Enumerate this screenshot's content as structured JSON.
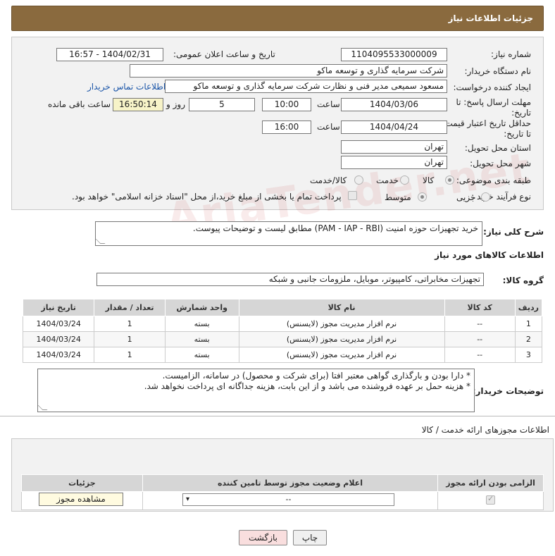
{
  "header": {
    "title": "جزئیات اطلاعات نیاز"
  },
  "form": {
    "need_number_label": "شماره نیاز:",
    "need_number": "1104095533000009",
    "announce_label": "تاریخ و ساعت اعلان عمومی:",
    "announce_value": "1404/02/31 - 16:57",
    "buyer_org_label": "نام دستگاه خریدار:",
    "buyer_org": "شرکت سرمایه گذاری و توسعه ماکو",
    "requester_label": "ایجاد کننده درخواست:",
    "requester": "مسعود سمیعی مدیر فنی و نظارت   شرکت سرمایه گذاری و توسعه ماکو",
    "contact_link": "اطلاعات تماس خریدار",
    "deadline_label": "مهلت ارسال پاسخ: تا تاریخ:",
    "deadline_date": "1404/03/06",
    "time_label": "ساعت",
    "deadline_time": "10:00",
    "days_value": "5",
    "days_label": "روز و",
    "remaining_value": "16:50:14",
    "remaining_label": "ساعت باقی مانده",
    "validity_label": "حداقل تاریخ اعتبار قیمت: تا تاریخ:",
    "validity_date": "1404/04/24",
    "validity_time": "16:00",
    "province_label": "استان محل تحویل:",
    "province": "تهران",
    "city_label": "شهر محل تحویل:",
    "city": "تهران",
    "category_label": "طبقه بندی موضوعی:",
    "category_options": [
      "کالا",
      "خدمت",
      "کالا/خدمت"
    ],
    "category_selected": "کالا",
    "process_label": "نوع فرآیند خرید :",
    "process_options": [
      "جزیی",
      "متوسط"
    ],
    "process_selected": "متوسط",
    "payment_note": "پرداخت تمام یا بخشی از مبلغ خرید،از محل \"اسناد خزانه اسلامی\" خواهد بود."
  },
  "watermark": "AriaTender.net",
  "description": {
    "label": "شرح کلی نیاز:",
    "text": "خرید تجهیزات حوزه امنیت (PAM - IAP - RBI) مطابق لیست و توضیحات پیوست."
  },
  "goods": {
    "section_title": "اطلاعات کالاهای مورد نیاز",
    "group_label": "گروه کالا:",
    "group_value": "تجهیزات مخابراتی، کامپیوتر، موبایل، ملزومات جانبی و شبکه",
    "columns": [
      "ردیف",
      "کد کالا",
      "نام کالا",
      "واحد شمارش",
      "تعداد / مقدار",
      "تاریخ نیاز"
    ],
    "rows": [
      {
        "index": "1",
        "code": "--",
        "name": "نرم افزار مدیریت مجوز (لایسنس)",
        "unit": "بسته",
        "qty": "1",
        "date": "1404/03/24"
      },
      {
        "index": "2",
        "code": "--",
        "name": "نرم افزار مدیریت مجوز (لایسنس)",
        "unit": "بسته",
        "qty": "1",
        "date": "1404/03/24"
      },
      {
        "index": "3",
        "code": "--",
        "name": "نرم افزار مدیریت مجوز (لایسنس)",
        "unit": "بسته",
        "qty": "1",
        "date": "1404/03/24"
      }
    ]
  },
  "buyer_notes": {
    "label": "توضیحات خریدار:",
    "line1": "* دارا بودن و بارگذاری گواهی معتبر افتا (برای شرکت و محصول) در سامانه، الزامیست.",
    "line2": "* هزینه حمل بر عهده فروشنده می باشد و از این بابت، هزینه جداگانه ای پرداخت نخواهد شد."
  },
  "permits": {
    "section_title": "اطلاعات مجوزهای ارائه خدمت / کالا",
    "columns": [
      "الزامی بودن ارائه مجوز",
      "اعلام وضعیت مجوز توسط تامین کننده",
      "جزئیات"
    ],
    "select_value": "--",
    "view_button": "مشاهده مجوز"
  },
  "actions": {
    "print": "چاپ",
    "back": "بازگشت"
  }
}
